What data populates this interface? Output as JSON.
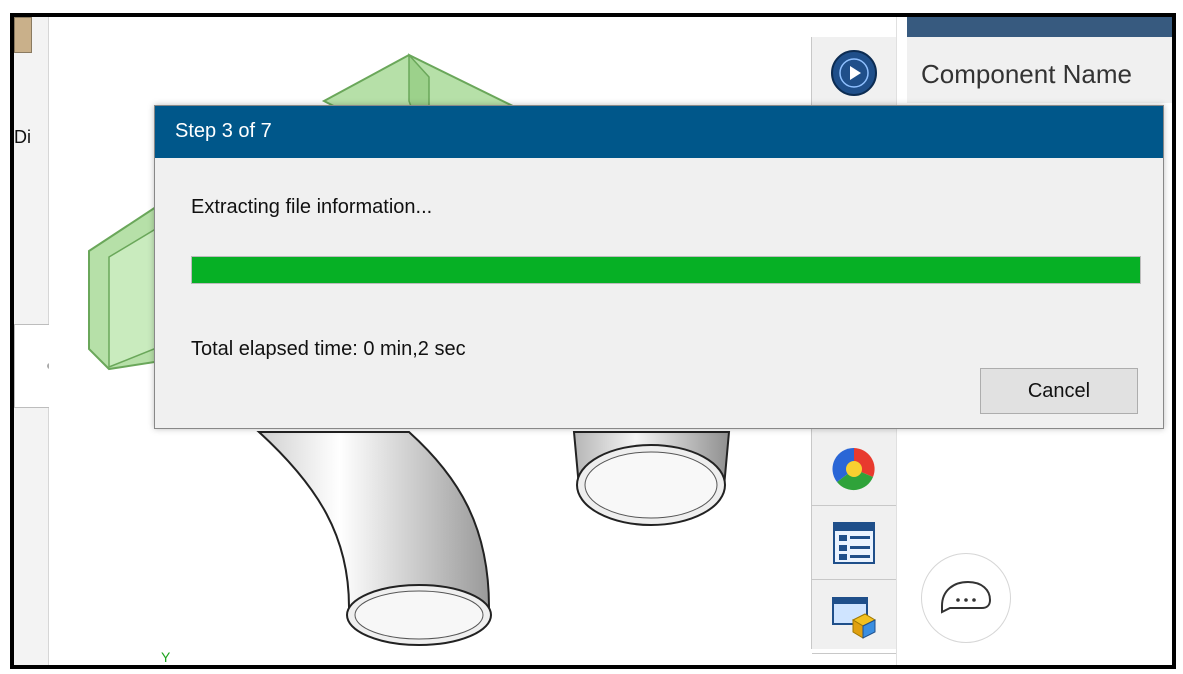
{
  "left_panel": {
    "tab_label": "Di",
    "caret": ">"
  },
  "viewport": {
    "axis_label": "Y"
  },
  "right_panel": {
    "component_name_header": "Component Name"
  },
  "toolbar_icons": [
    "globe-play-icon",
    "color-wheel-icon",
    "list-view-icon",
    "display-pane-icon"
  ],
  "dialog": {
    "title": "Step 3 of 7",
    "message": "Extracting file information...",
    "progress": 1.0,
    "progress_color": "#06b025",
    "elapsed": "Total elapsed time: 0 min,2 sec",
    "cancel_label": "Cancel"
  },
  "colors": {
    "dialog_title_bg": "#00578a",
    "green_part": "#b6e0a8"
  }
}
